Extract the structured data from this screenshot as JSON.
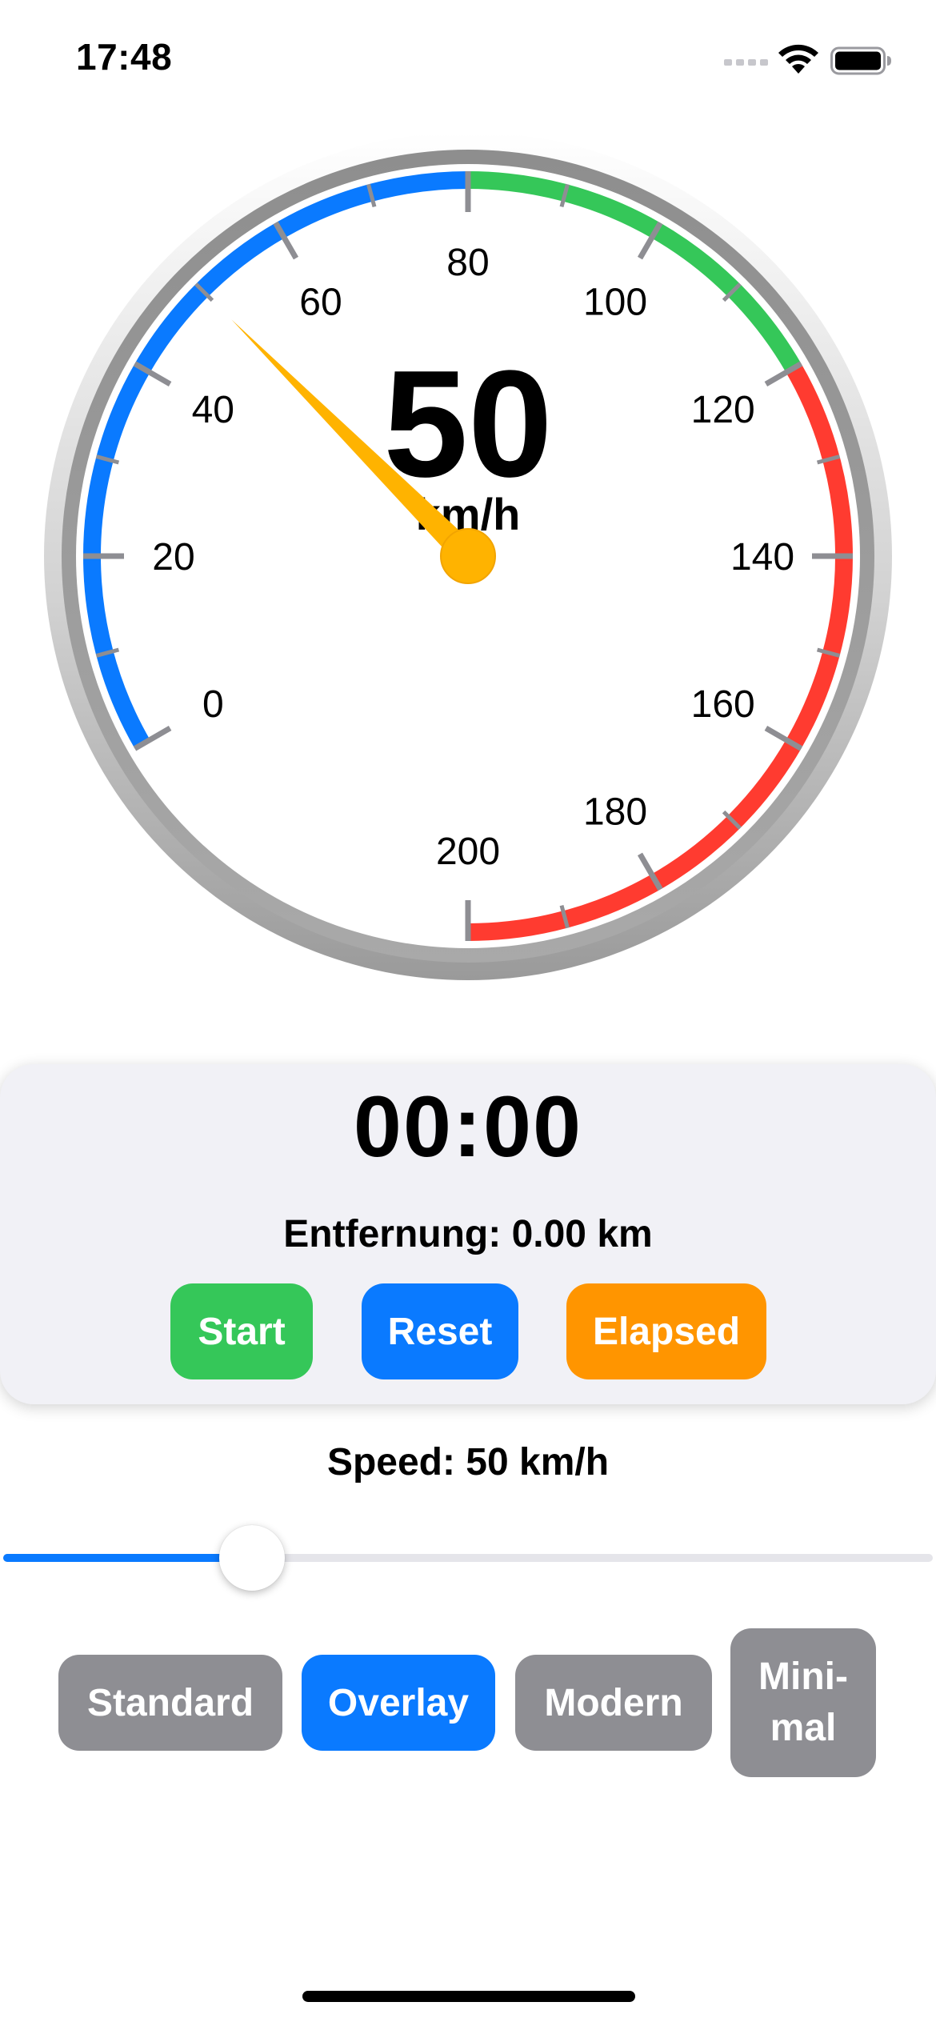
{
  "status_bar": {
    "time": "17:48"
  },
  "speedometer": {
    "value": 50,
    "value_text": "50",
    "unit": "km/h",
    "min": 0,
    "max": 200,
    "scale_labels": [
      "0",
      "20",
      "40",
      "60",
      "80",
      "100",
      "120",
      "140",
      "160",
      "180",
      "200"
    ],
    "zones": [
      {
        "from": 0,
        "to": 80,
        "color": "#0a7aff"
      },
      {
        "from": 80,
        "to": 120,
        "color": "#35c759"
      },
      {
        "from": 120,
        "to": 200,
        "color": "#ff3b30"
      }
    ],
    "needle_color": "#ffb300"
  },
  "stopwatch": {
    "time": "00:00",
    "distance": "Entfernung: 0.00 km",
    "buttons": {
      "start": "Start",
      "reset": "Reset",
      "elapsed": "Elapsed"
    }
  },
  "speed_control": {
    "label": "Speed: 50 km/h",
    "value": 50,
    "min": 0,
    "max": 200
  },
  "modes": {
    "standard": "Standard",
    "overlay": "Overlay",
    "modern": "Modern",
    "minimal_line1": "Mini-",
    "minimal_line2": "mal",
    "selected": "Overlay"
  },
  "colors": {
    "accent": "#0a7aff",
    "green": "#35c759",
    "orange": "#ff9500",
    "gray": "#8e8e93"
  }
}
